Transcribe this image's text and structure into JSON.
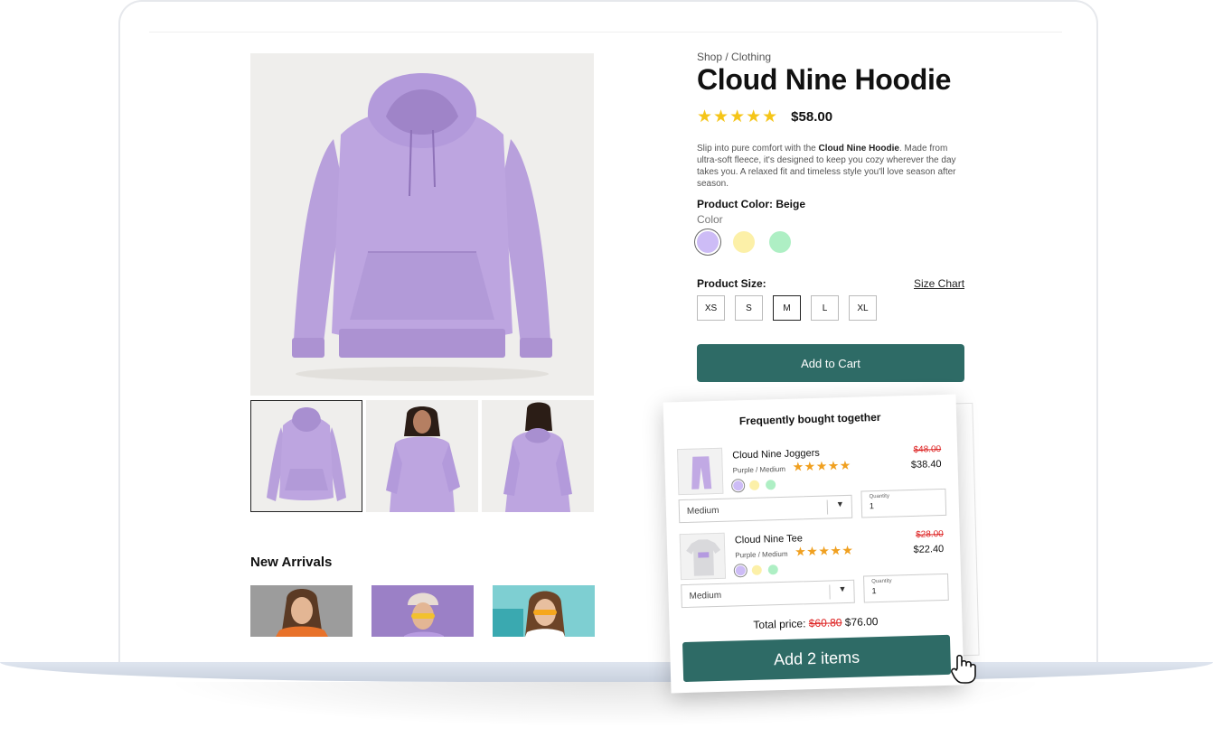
{
  "product": {
    "breadcrumb": "Shop / Clothing",
    "title": "Cloud Nine Hoodie",
    "rating_stars": "★★★★★",
    "rating_value": 4.5,
    "price": "$58.00",
    "description": {
      "before": "Slip into pure comfort with the ",
      "bold": "Cloud Nine Hoodie",
      "after": ". Made from ultra-soft fleece, it's designed to keep you cozy wherever the day takes you. A relaxed fit and timeless style you'll love season after season."
    },
    "color_label": "Product Color: Beige",
    "color_sub": "Color",
    "colors": [
      {
        "name": "lavender",
        "hex": "#cdbcf6",
        "selected": true
      },
      {
        "name": "yellow",
        "hex": "#fcf0a8",
        "selected": false
      },
      {
        "name": "mint",
        "hex": "#aeefc4",
        "selected": false
      }
    ],
    "size_label": "Product Size:",
    "size_chart": "Size Chart",
    "sizes": [
      {
        "label": "XS",
        "selected": false
      },
      {
        "label": "S",
        "selected": false
      },
      {
        "label": "M",
        "selected": true
      },
      {
        "label": "L",
        "selected": false
      },
      {
        "label": "XL",
        "selected": false
      }
    ],
    "add_to_cart": "Add to Cart"
  },
  "new_arrivals": {
    "title": "New Arrivals"
  },
  "bundle": {
    "title": "Frequently bought together",
    "items": [
      {
        "name": "Cloud Nine Joggers",
        "variant": "Purple / Medium",
        "stars": "★★★★★",
        "old_price": "$48.00",
        "price": "$38.40",
        "size_select": "Medium",
        "qty_label": "Quantity",
        "qty": "1"
      },
      {
        "name": "Cloud Nine Tee",
        "variant": "Purple / Medium",
        "stars": "★★★★★",
        "old_price": "$28.00",
        "price": "$22.40",
        "size_select": "Medium",
        "qty_label": "Quantity",
        "qty": "1"
      }
    ],
    "total_label": "Total price:",
    "total_old": "$60.80",
    "total_new": "$76.00",
    "add_button": "Add 2 items"
  },
  "colors": {
    "accent": "#2e6b66",
    "hoodie": "#b9a0dc",
    "sale_red": "#d22222",
    "star_yellow": "#f5c518"
  }
}
